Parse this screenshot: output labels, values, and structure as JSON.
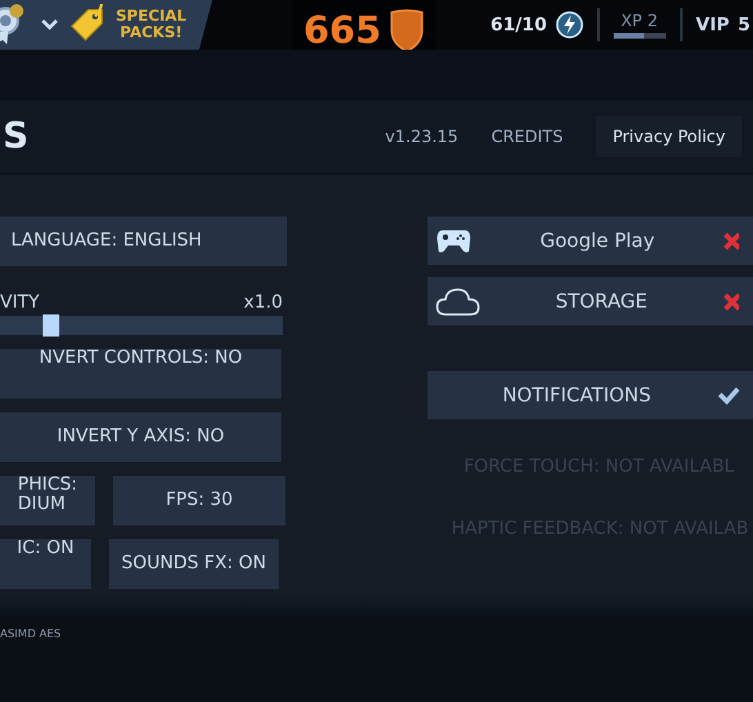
{
  "top_bar": {
    "promo": {
      "label": "SPECIAL\nPACKS!"
    },
    "score": "665",
    "energy": "61/10",
    "xp": {
      "label": "XP 2",
      "level": 0.6
    },
    "vip": {
      "label": "VIP",
      "value": "5"
    }
  },
  "header": {
    "title": "S",
    "version": "v1.23.15",
    "links": [
      {
        "label": "CREDITS",
        "kind": "link"
      },
      {
        "label": "Privacy Policy",
        "kind": "button"
      }
    ]
  },
  "left": {
    "language": "LANGUAGE: ENGLISH",
    "sensitivity": {
      "label": "VITY",
      "reading": "x1.0",
      "level": 0.17
    },
    "rows": [
      [
        {
          "label": "NVERT CONTROLS: NO"
        }
      ],
      [
        {
          "label": "INVERT Y AXIS: NO"
        }
      ],
      [
        {
          "label": "PHICS:\nDIUM"
        },
        {
          "label": "FPS: 30"
        }
      ],
      [
        {
          "label": "IC: ON"
        },
        {
          "label": "SOUNDS FX: ON"
        }
      ]
    ],
    "footer": "ASIMD AES"
  },
  "right": {
    "services": [
      {
        "label": "Google Play",
        "kind": "gamepad",
        "connected": false
      },
      {
        "label": "STORAGE",
        "kind": "cloud",
        "connected": false
      }
    ],
    "notifications": {
      "label": "NOTIFICATIONS",
      "checked": true
    },
    "notes": [
      {
        "label": "FORCE TOUCH: NOT AVAILABL",
        "disabled": true
      },
      {
        "label": "HAPTIC FEEDBACK: NOT AVAILAB",
        "disabled": true
      }
    ]
  }
}
